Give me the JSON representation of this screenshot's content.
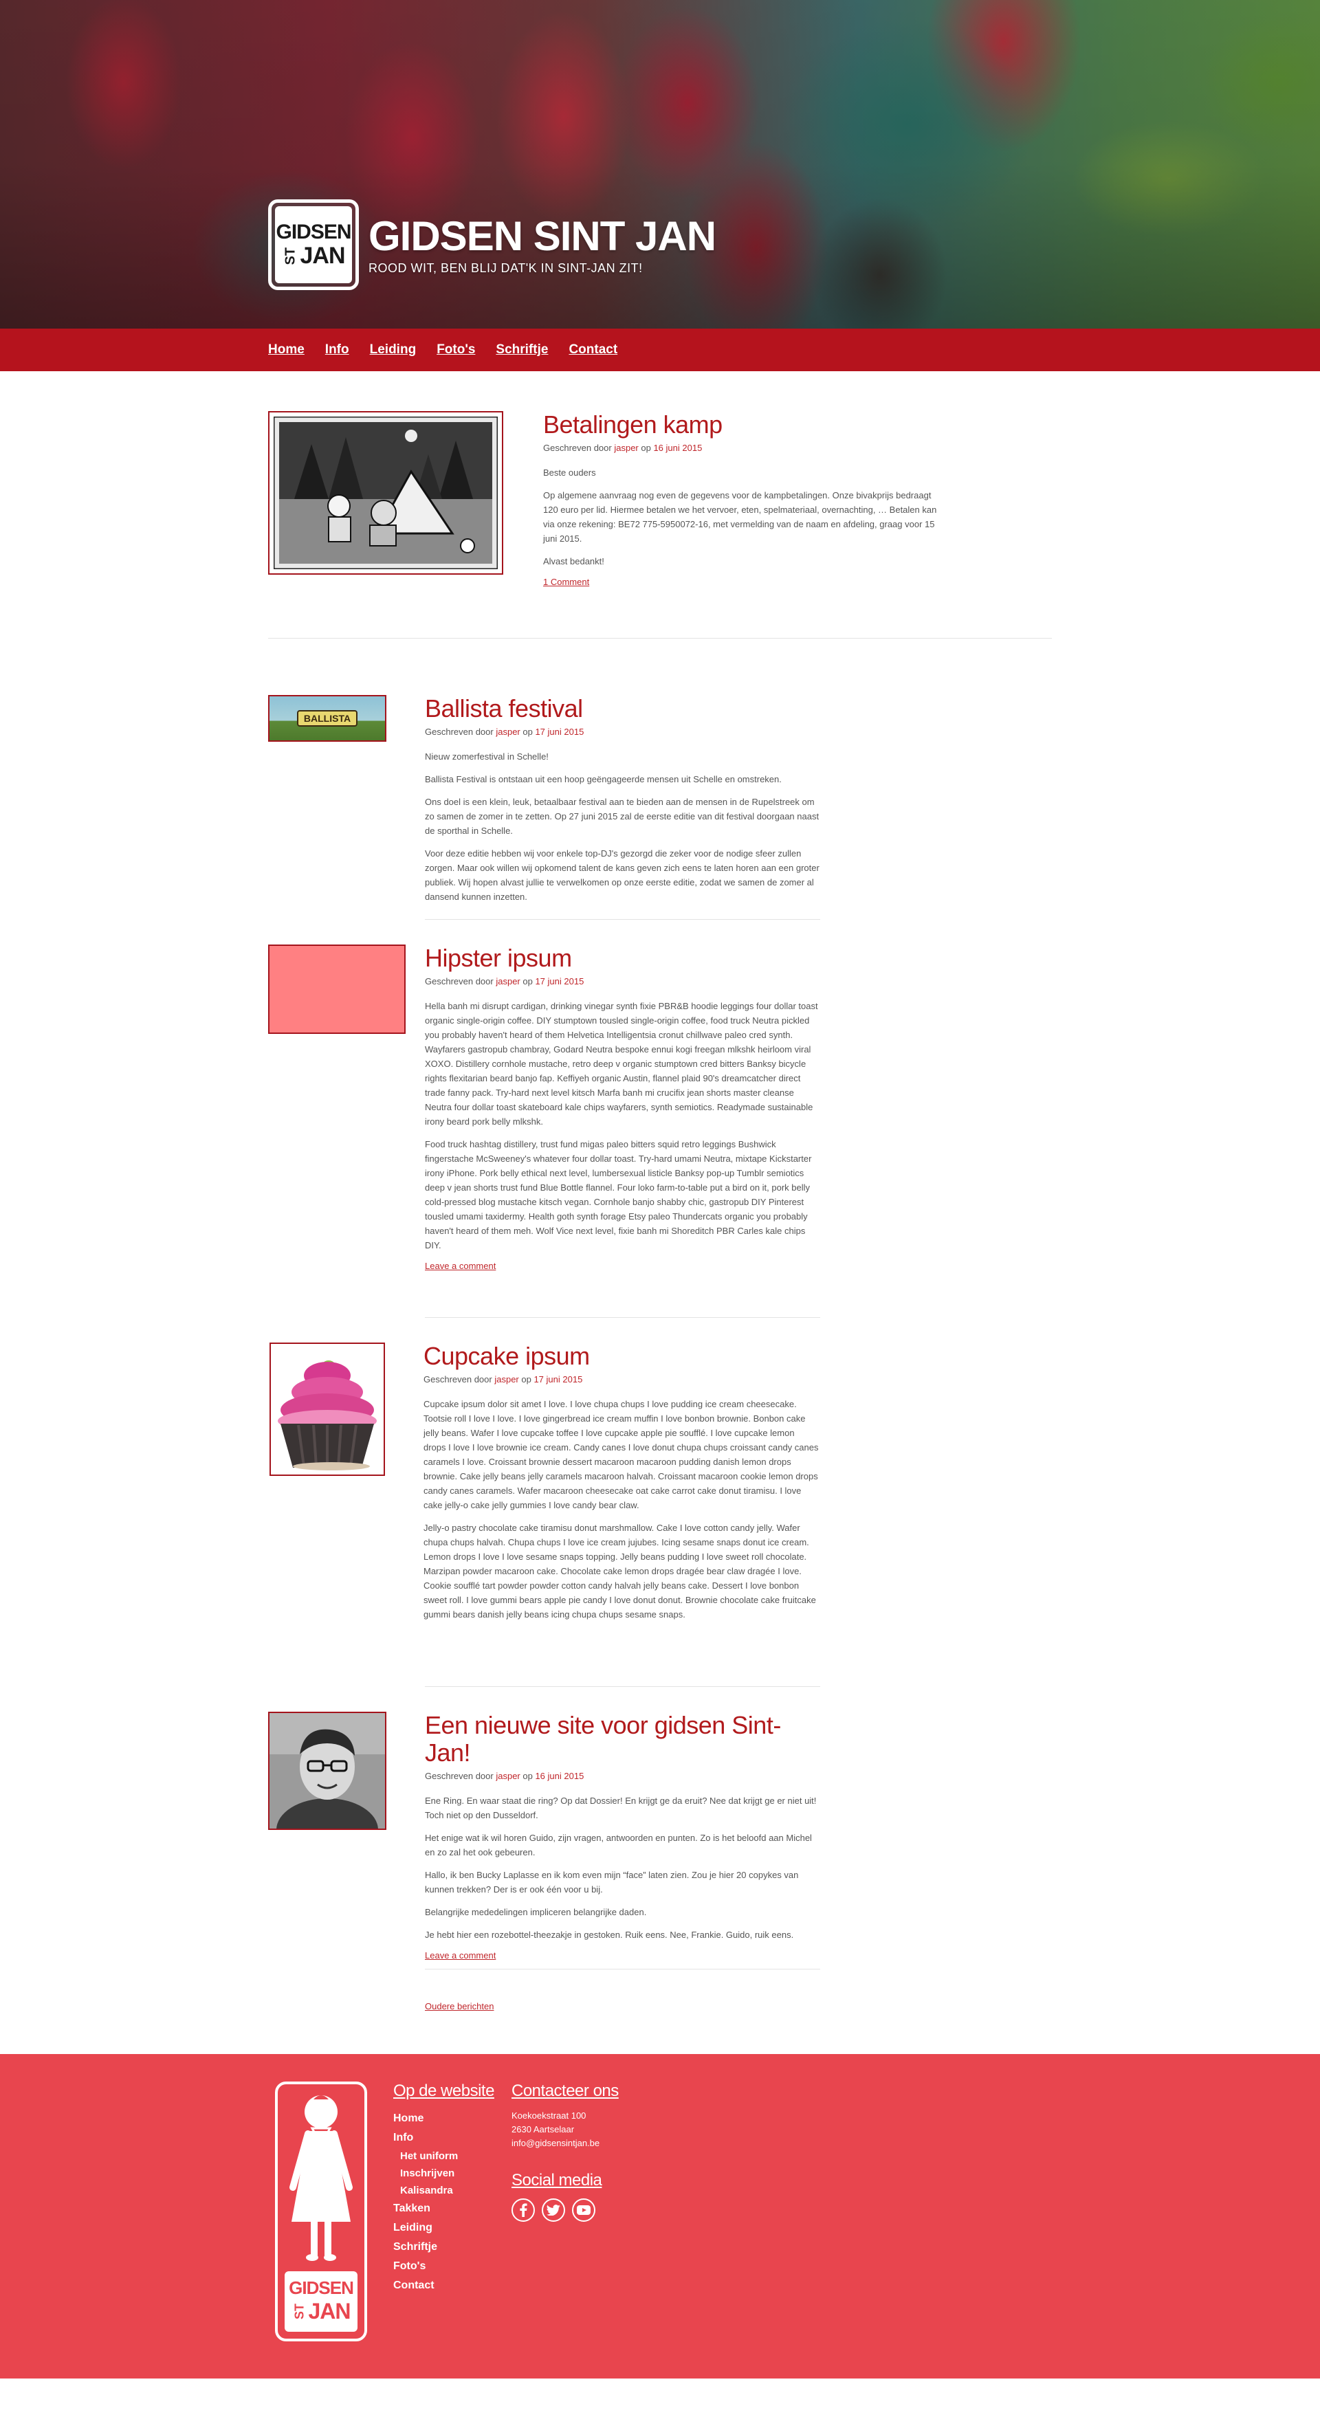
{
  "site": {
    "title": "GIDSEN SINT JAN",
    "tagline": "ROOD WIT, BEN BLIJ DAT'K IN SINT-JAN ZIT!",
    "logo_text_top": "GIDSEN",
    "logo_text_st": "ST",
    "logo_text_jan": "JAN"
  },
  "nav": [
    "Home",
    "Info",
    "Leiding",
    "Foto's",
    "Schriftje",
    "Contact"
  ],
  "posts": [
    {
      "title": "Betalingen kamp",
      "meta_prefix": "Geschreven door ",
      "author": "jasper",
      "meta_mid": " op ",
      "date": "16 juni 2015",
      "paragraphs": [
        "Beste ouders",
        "Op algemene aanvraag nog even de gegevens voor de kampbetalingen. Onze bivakprijs bedraagt 120 euro per lid. Hiermee betalen we het vervoer, eten, spelmateriaal, overnachting, … Betalen kan via onze rekening: BE72 775-5950072-16, met vermelding van de naam en afdeling, graag voor 15 juni 2015.",
        "Alvast bedankt!"
      ],
      "link": "1 Comment"
    },
    {
      "title": "Ballista festival",
      "meta_prefix": "Geschreven door ",
      "author": "jasper",
      "meta_mid": " op ",
      "date": "17 juni 2015",
      "image_text": "BALLISTA",
      "paragraphs": [
        "Nieuw zomerfestival in Schelle!",
        "Ballista Festival is ontstaan uit een hoop geëngageerde mensen uit Schelle en omstreken.",
        "Ons doel is een klein, leuk, betaalbaar festival aan te bieden aan de mensen in de Rupelstreek om zo samen de zomer in te zetten. Op 27 juni 2015 zal de eerste editie van dit festival doorgaan naast de sporthal in Schelle.",
        "Voor deze editie hebben wij voor enkele top-DJ's gezorgd die zeker voor de nodige sfeer zullen zorgen. Maar ook willen wij opkomend talent de kans geven zich eens te laten horen aan een groter publiek. Wij hopen alvast jullie te verwelkomen op onze eerste editie, zodat we samen de zomer al dansend kunnen inzetten."
      ],
      "link": ""
    },
    {
      "title": "Hipster ipsum",
      "meta_prefix": "Geschreven door ",
      "author": "jasper",
      "meta_mid": " op ",
      "date": "17 juni 2015",
      "paragraphs": [
        "Hella banh mi disrupt cardigan, drinking vinegar synth fixie PBR&B hoodie leggings four dollar toast organic single-origin coffee. DIY stumptown tousled single-origin coffee, food truck Neutra pickled you probably haven't heard of them Helvetica Intelligentsia cronut chillwave paleo cred synth. Wayfarers gastropub chambray, Godard Neutra bespoke ennui kogi freegan mlkshk heirloom viral XOXO. Distillery cornhole mustache, retro deep v organic stumptown cred bitters Banksy bicycle rights flexitarian beard banjo fap. Keffiyeh organic Austin, flannel plaid 90's dreamcatcher direct trade fanny pack. Try-hard next level kitsch Marfa banh mi crucifix jean shorts master cleanse Neutra four dollar toast skateboard kale chips wayfarers, synth semiotics. Readymade sustainable irony beard pork belly mlkshk.",
        "Food truck hashtag distillery, trust fund migas paleo bitters squid retro leggings Bushwick fingerstache McSweeney's whatever four dollar toast. Try-hard umami Neutra, mixtape Kickstarter irony iPhone. Pork belly ethical next level, lumbersexual listicle Banksy pop-up Tumblr semiotics deep v jean shorts trust fund Blue Bottle flannel. Four loko farm-to-table put a bird on it, pork belly cold-pressed blog mustache kitsch vegan. Cornhole banjo shabby chic, gastropub DIY Pinterest tousled umami taxidermy. Health goth synth forage Etsy paleo Thundercats organic you probably haven't heard of them meh. Wolf Vice next level, fixie banh mi Shoreditch PBR Carles kale chips DIY."
      ],
      "link": "Leave a comment"
    },
    {
      "title": "Cupcake ipsum",
      "meta_prefix": "Geschreven door ",
      "author": "jasper",
      "meta_mid": " op ",
      "date": "17 juni 2015",
      "paragraphs": [
        "Cupcake ipsum dolor sit amet I love. I love chupa chups I love pudding ice cream cheesecake. Tootsie roll I love I love. I love gingerbread ice cream muffin I love bonbon brownie. Bonbon cake jelly beans. Wafer I love cupcake toffee I love cupcake apple pie soufflé. I love cupcake lemon drops I love I love brownie ice cream. Candy canes I love donut chupa chups croissant candy canes caramels I love. Croissant brownie dessert macaroon macaroon pudding danish lemon drops brownie. Cake jelly beans jelly caramels macaroon halvah. Croissant macaroon cookie lemon drops candy canes caramels. Wafer macaroon cheesecake oat cake carrot cake donut tiramisu. I love cake jelly-o cake jelly gummies I love candy bear claw.",
        "Jelly-o pastry chocolate cake tiramisu donut marshmallow. Cake I love cotton candy jelly. Wafer chupa chups halvah. Chupa chups I love ice cream jujubes. Icing sesame snaps donut ice cream. Lemon drops I love I love sesame snaps topping. Jelly beans pudding I love sweet roll chocolate. Marzipan powder macaroon cake. Chocolate cake lemon drops dragée bear claw dragée I love. Cookie soufflé tart powder powder cotton candy halvah jelly beans cake. Dessert I love bonbon sweet roll. I love gummi bears apple pie candy I love donut donut. Brownie chocolate cake fruitcake gummi bears danish jelly beans icing chupa chups sesame snaps."
      ],
      "link": ""
    },
    {
      "title": "Een nieuwe site voor gidsen Sint-Jan!",
      "meta_prefix": "Geschreven door ",
      "author": "jasper",
      "meta_mid": " op ",
      "date": "16 juni 2015",
      "paragraphs": [
        "Ene Ring. En waar staat die ring? Op dat Dossier! En krijgt ge da eruit? Nee dat krijgt ge er niet uit! Toch niet op den Dusseldorf.",
        "Het enige wat ik wil horen Guido, zijn vragen, antwoorden en punten. Zo is het beloofd aan Michel en zo zal het ook gebeuren.",
        "Hallo, ik ben Bucky Laplasse en ik kom even mijn “face” laten zien. Zou je hier 20 copykes van kunnen trekken? Der is er ook één voor u bij.",
        "Belangrijke mededelingen impliceren belangrijke daden.",
        "Je hebt hier een rozebottel-theezakje in gestoken. Ruik eens. Nee, Frankie. Guido, ruik eens."
      ],
      "link": "Leave a comment"
    }
  ],
  "older_posts": "Oudere berichten",
  "footer": {
    "site_heading": "Op de website",
    "site_links": [
      {
        "label": "Home",
        "sub": false
      },
      {
        "label": "Info",
        "sub": false
      },
      {
        "label": "Het uniform",
        "sub": true
      },
      {
        "label": "Inschrijven",
        "sub": true
      },
      {
        "label": "Kalisandra",
        "sub": true
      },
      {
        "label": "Takken",
        "sub": false
      },
      {
        "label": "Leiding",
        "sub": false
      },
      {
        "label": "Schriftje",
        "sub": false
      },
      {
        "label": "Foto's",
        "sub": false
      },
      {
        "label": "Contact",
        "sub": false
      }
    ],
    "contact_heading": "Contacteer ons",
    "address_line1": "Koekoekstraat 100",
    "address_line2": "2630 Aartselaar",
    "email": "info@gidsensintjan.be",
    "social_heading": "Social media",
    "social_icons": [
      "facebook-icon",
      "twitter-icon",
      "youtube-icon"
    ]
  },
  "colors": {
    "brand_red": "#b5131d",
    "title_red": "#b11a1c",
    "footer_red": "#e8454e",
    "link_red": "#c0262b"
  }
}
